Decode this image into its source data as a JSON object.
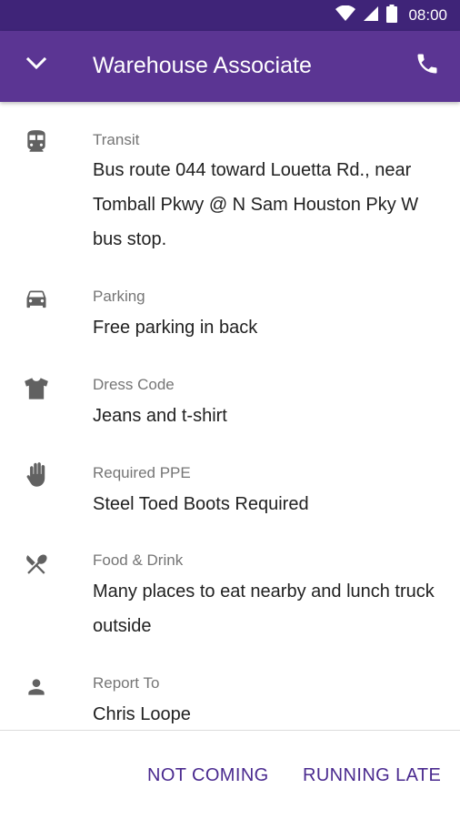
{
  "status_bar": {
    "time": "08:00",
    "icons": [
      "wifi-icon",
      "cellular-icon",
      "battery-icon"
    ]
  },
  "app_bar": {
    "title": "Warehouse Associate",
    "left_icon": "chevron-down-icon",
    "right_icon": "phone-icon"
  },
  "details": [
    {
      "icon": "train-icon",
      "label": "Transit",
      "value": "Bus route 044 toward Louetta Rd., near Tomball Pkwy @ N Sam Houston Pky W bus stop."
    },
    {
      "icon": "car-icon",
      "label": "Parking",
      "value": "Free parking in back"
    },
    {
      "icon": "shirt-icon",
      "label": "Dress Code",
      "value": "Jeans and t-shirt"
    },
    {
      "icon": "glove-icon",
      "label": "Required PPE",
      "value": "Steel Toed Boots Required"
    },
    {
      "icon": "fork-knife-icon",
      "label": "Food & Drink",
      "value": "Many places to eat nearby and lunch truck outside"
    },
    {
      "icon": "person-icon",
      "label": "Report To",
      "value": "Chris Loope"
    }
  ],
  "actions": {
    "not_coming": "NOT COMING",
    "running_late": "RUNNING LATE"
  },
  "colors": {
    "status_bar": "#3f2478",
    "app_bar": "#5b3593",
    "action_text": "#4a2a8f",
    "icon": "#616161"
  }
}
